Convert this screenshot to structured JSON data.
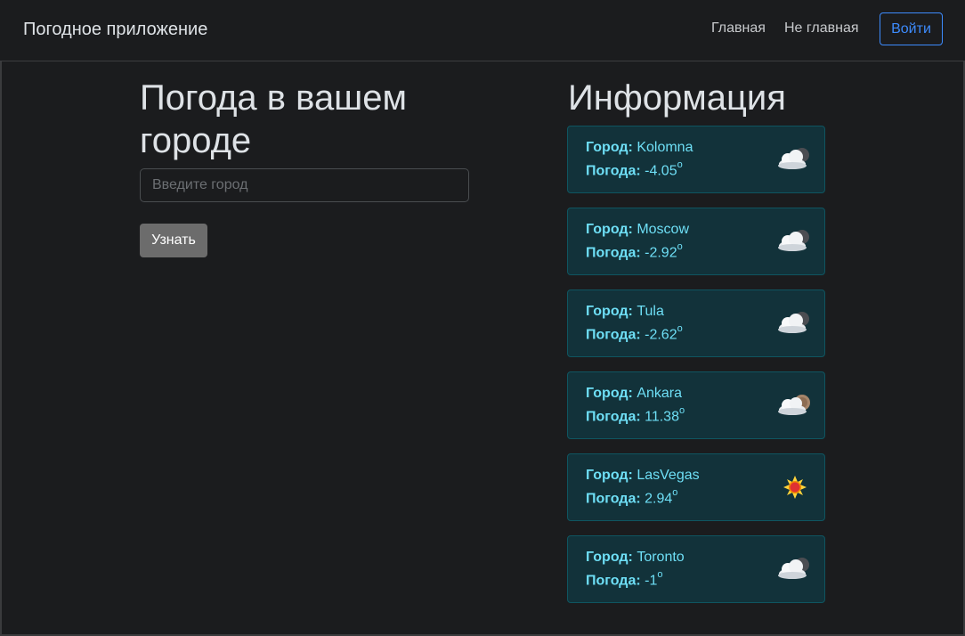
{
  "navbar": {
    "brand": "Погодное приложение",
    "links": [
      {
        "label": "Главная"
      },
      {
        "label": "Не главная"
      }
    ],
    "login_label": "Войти"
  },
  "search": {
    "title": "Погода в вашем городе",
    "placeholder": "Введите город",
    "button_label": "Узнать"
  },
  "info": {
    "title": "Информация",
    "city_label": "Город:",
    "weather_label": "Погода:",
    "degree_sign": "o",
    "cards": [
      {
        "city": "Kolomna",
        "temp": "-4.05",
        "icon": "cloudy-night-icon"
      },
      {
        "city": "Moscow",
        "temp": "-2.92",
        "icon": "cloudy-night-icon"
      },
      {
        "city": "Tula",
        "temp": "-2.62",
        "icon": "cloudy-night-icon"
      },
      {
        "city": "Ankara",
        "temp": "11.38",
        "icon": "partly-cloudy-icon"
      },
      {
        "city": "LasVegas",
        "temp": "2.94",
        "icon": "sun-icon"
      },
      {
        "city": "Toronto",
        "temp": "-1",
        "icon": "cloudy-night-icon"
      }
    ]
  },
  "colors": {
    "background": "#1b1c1e",
    "card_bg": "#12323a",
    "card_border": "#0f5560",
    "card_text": "#6edff6",
    "accent": "#3d8bfd",
    "button_bg": "#6c6c6c"
  }
}
